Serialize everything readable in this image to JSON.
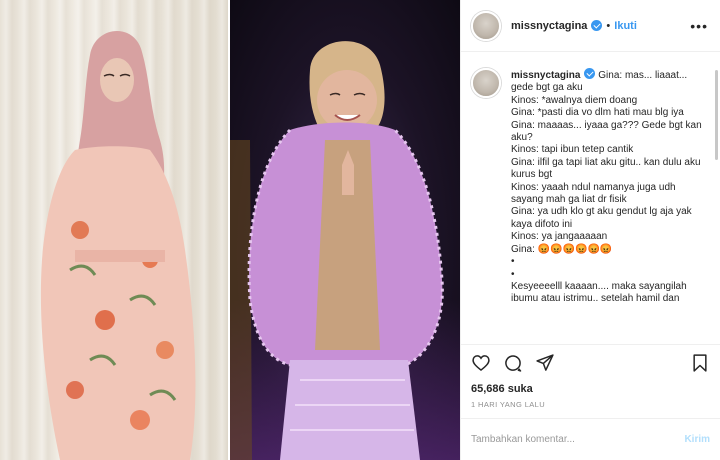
{
  "post": {
    "username": "missnyctagina",
    "follow_label": "Ikuti",
    "separator": "•",
    "more_label": "•••"
  },
  "caption": {
    "username": "missnyctagina",
    "text": " Gina: mas... liaaat... gede bgt ga aku\nKinos: *awalnya diem doang\nGina: *pasti dia vo dlm hati mau blg iya\nGina: maaaas... iyaaa ga??? Gede bgt kan aku?\nKinos: tapi ibun tetep cantik\nGina: ilfil ga tapi liat aku gitu.. kan dulu aku kurus bgt\nKinos: yaaah ndul namanya juga udh sayang mah ga liat dr fisik\nGina: ya udh klo gt aku gendut lg aja yak kaya difoto ini\nKinos: ya jangaaaaan\nGina: 😡😡😡😡😡😡\n•\n•\nKesyeeeelll kaaaan.... maka sayangilah ibumu atau istrimu.. setelah hamil dan"
  },
  "stats": {
    "likes": "65,686 suka",
    "time": "1 HARI YANG LALU"
  },
  "comment_box": {
    "placeholder": "Tambahkan komentar...",
    "send_label": "Kirim"
  },
  "icons": {
    "like": "heart-icon",
    "comment": "comment-icon",
    "share": "share-icon",
    "save": "bookmark-icon"
  },
  "colors": {
    "accent": "#3897f0",
    "verified": "#3897f0",
    "send_disabled": "#b2dffc",
    "muted": "#8e8e8e"
  }
}
